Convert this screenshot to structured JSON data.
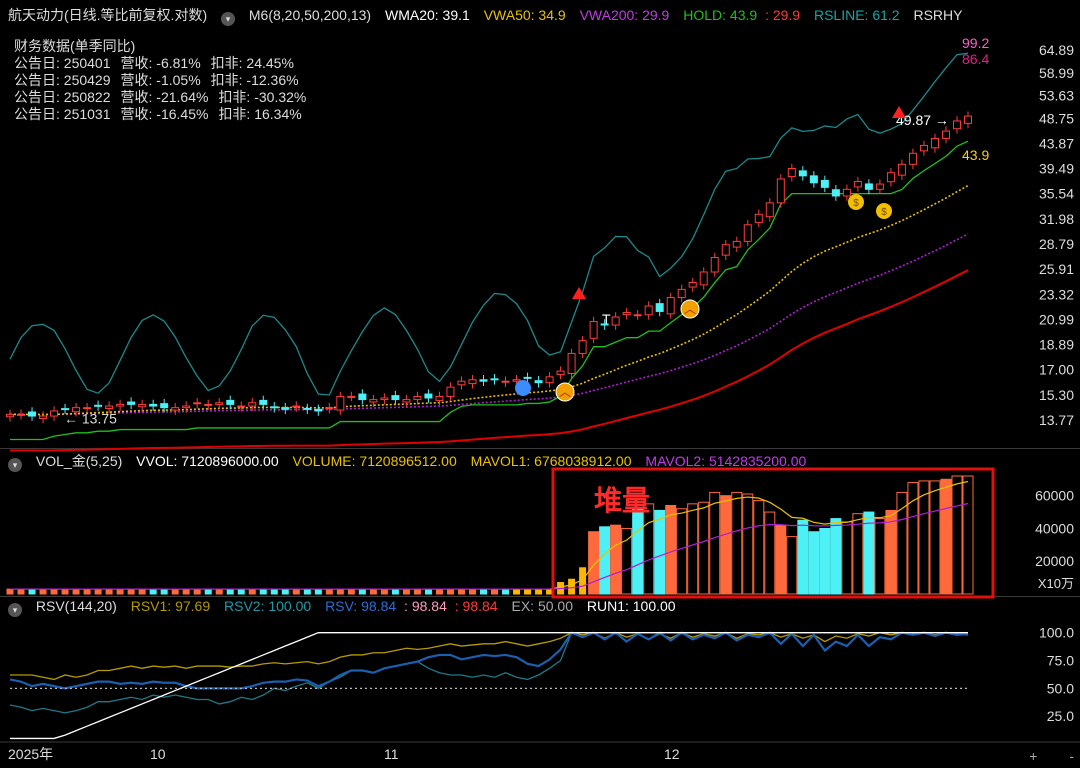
{
  "title": "航天动力(日线.等比前复权.对数)",
  "main_header": {
    "m6": "M6(8,20,50,200,13)",
    "wma20": "WMA20: 39.1",
    "vwa50": "VWA50: 34.9",
    "vwa200": "VWA200: 29.9",
    "hold": "HOLD: 43.9",
    "hold_val2": ": 29.9",
    "rsline": "RSLINE: 61.2",
    "rsrhy": "RSRHY"
  },
  "financial": {
    "title": "财务数据(单季同比)",
    "rows": [
      {
        "date": "公告日: 250401",
        "rev": "营收:  -6.81%",
        "net": "扣非:  24.45%"
      },
      {
        "date": "公告日: 250429",
        "rev": "营收:  -1.05%",
        "net": "扣非:  -12.36%"
      },
      {
        "date": "公告日: 250822",
        "rev": "营收:  -21.64%",
        "net": "扣非:  -30.32%"
      },
      {
        "date": "公告日: 251031",
        "rev": "营收:  -16.45%",
        "net": "扣非:  16.34%"
      }
    ]
  },
  "annotations": {
    "low_label": "13.75",
    "high_label": "49.87",
    "rs_val_pink": "99.2",
    "rs_val_magenta": "86.4",
    "hold_label": "43.9",
    "t_marker": "T",
    "stacked_volume": "堆量"
  },
  "vol_header": {
    "name": "VOL_金(5,25)",
    "vvol": "VVOL: 7120896000.00",
    "volume": "VOLUME: 7120896512.00",
    "mavol1": "MAVOL1: 6768038912.00",
    "mavol2": "MAVOL2: 5142835200.00"
  },
  "rsv_header": {
    "name": "RSV(144,20)",
    "rsv1": "RSV1: 97.69",
    "rsv2": "RSV2: 100.00",
    "rsv": "RSV: 98.84",
    "v1": ": 98.84",
    "v2": ": 98.84",
    "ex": "EX: 50.00",
    "run1": "RUN1: 100.00"
  },
  "x_axis": {
    "labels": [
      "2025年",
      "10",
      "11",
      "12"
    ]
  },
  "vol_unit": "X10万",
  "nav": {
    "plus": "+",
    "minus": "-"
  },
  "colors": {
    "up": "#ff3b3b",
    "down": "#4df0f5",
    "wma20": "#ffd400",
    "vwa50": "#e8c200",
    "vwa200": "#b01ed8",
    "hold": "#1fbf1f",
    "red": "#e00000",
    "rsline": "#1b8a8a",
    "white": "#ffffff",
    "rsv1": "#b59a00",
    "rsv2": "#1d7a86",
    "rsv": "#1a5fb0",
    "pink": "#ff9cc0",
    "vol_up": "#ff6a3d",
    "vol_gold": "#ffb400",
    "frame": "#e01010"
  },
  "chart_data": [
    {
      "type": "candlestick",
      "title": "航天动力(日线.等比前复权.对数)",
      "y_scale": "log",
      "y_ticks": [
        64.89,
        58.99,
        53.63,
        48.75,
        43.87,
        39.49,
        35.54,
        31.98,
        28.79,
        25.91,
        23.32,
        20.99,
        18.89,
        17.0,
        15.3,
        13.77
      ],
      "x_labels": [
        "2025年",
        "10",
        "11",
        "12"
      ],
      "close": [
        14.1,
        14.1,
        14.0,
        14.0,
        14.3,
        14.4,
        14.5,
        14.5,
        14.6,
        14.6,
        14.7,
        14.7,
        14.7,
        14.6,
        14.5,
        14.5,
        14.6,
        14.8,
        14.7,
        14.8,
        14.7,
        14.6,
        14.8,
        14.7,
        14.5,
        14.4,
        14.6,
        14.4,
        14.3,
        14.5,
        15.2,
        15.2,
        15.0,
        15.0,
        15.1,
        15.0,
        15.0,
        15.2,
        15.1,
        15.2,
        15.8,
        16.2,
        16.3,
        16.2,
        16.3,
        16.2,
        16.3,
        16.4,
        16.1,
        16.5,
        16.9,
        18.2,
        19.2,
        20.8,
        20.5,
        21.2,
        21.6,
        21.4,
        22.2,
        21.7,
        23.0,
        23.8,
        24.5,
        25.6,
        27.2,
        28.7,
        29.1,
        31.2,
        32.6,
        34.2,
        37.8,
        39.5,
        38.3,
        37.2,
        36.5,
        35.2,
        36.2,
        37.4,
        36.2,
        37.0,
        38.8,
        40.2,
        42.1,
        43.5,
        44.8,
        46.2,
        48.2,
        49.2
      ],
      "volume_x10wan": [
        3000,
        3000,
        3000,
        3000,
        3000,
        3000,
        3000,
        3000,
        3000,
        3000,
        3000,
        3000,
        3000,
        3000,
        3000,
        3000,
        3000,
        3000,
        3000,
        3000,
        3000,
        3000,
        3000,
        3000,
        3000,
        3000,
        3000,
        3000,
        3000,
        3000,
        3000,
        3000,
        3000,
        3000,
        3000,
        3000,
        3000,
        3000,
        3000,
        3000,
        3000,
        3000,
        3000,
        3000,
        3000,
        3000,
        3000,
        3000,
        3000,
        3000,
        7000,
        9000,
        16000,
        38000,
        41000,
        42000,
        40000,
        52000,
        55000,
        51000,
        54000,
        52000,
        55000,
        56000,
        62000,
        60000,
        62000,
        61000,
        57000,
        50000,
        42000,
        35000,
        45000,
        38000,
        40000,
        46000,
        44000,
        49000,
        50000,
        46000,
        51000,
        62000,
        68000,
        69000,
        69000,
        70000,
        72000,
        72000
      ],
      "ylim_volume": [
        0,
        72000
      ]
    },
    {
      "type": "line",
      "title": "RSV(144,20)",
      "y_ticks": [
        100.0,
        75.0,
        50.0,
        25.0
      ],
      "series": [
        {
          "name": "RSV1",
          "values": [
            62,
            62,
            62,
            60,
            58,
            62,
            60,
            62,
            66,
            66,
            68,
            70,
            68,
            70,
            69,
            70,
            68,
            70,
            70,
            70,
            69,
            70,
            70,
            72,
            73,
            72,
            73,
            74,
            72,
            74,
            78,
            80,
            80,
            82,
            82,
            84,
            86,
            85,
            86,
            88,
            90,
            88,
            89,
            90,
            90,
            92,
            90,
            88,
            90,
            92,
            95,
            100,
            98,
            100,
            95,
            100,
            96,
            99,
            94,
            99,
            95,
            100,
            96,
            99,
            97,
            100,
            95,
            99,
            98,
            100,
            96,
            99,
            95,
            98,
            92,
            97,
            95,
            99,
            97,
            100,
            98,
            100,
            99,
            100,
            98,
            100,
            99,
            98
          ]
        },
        {
          "name": "RSV2",
          "values": [
            35,
            33,
            30,
            32,
            30,
            28,
            30,
            33,
            38,
            38,
            40,
            42,
            40,
            44,
            42,
            44,
            42,
            40,
            40,
            36,
            38,
            42,
            40,
            44,
            50,
            48,
            52,
            55,
            50,
            56,
            60,
            66,
            66,
            64,
            68,
            70,
            72,
            74,
            68,
            64,
            62,
            62,
            60,
            62,
            60,
            64,
            60,
            58,
            62,
            68,
            75,
            100,
            100,
            100,
            100,
            100,
            100,
            100,
            100,
            100,
            100,
            100,
            100,
            100,
            100,
            100,
            100,
            100,
            100,
            100,
            100,
            100,
            100,
            100,
            100,
            100,
            100,
            100,
            100,
            100,
            100,
            100,
            100,
            100,
            100,
            100,
            100,
            100
          ]
        },
        {
          "name": "RSV",
          "values": [
            58,
            56,
            52,
            54,
            52,
            50,
            52,
            54,
            56,
            56,
            54,
            55,
            54,
            56,
            55,
            55,
            52,
            50,
            50,
            50,
            50,
            50,
            52,
            55,
            56,
            56,
            58,
            57,
            52,
            56,
            62,
            66,
            66,
            64,
            68,
            70,
            72,
            74,
            78,
            80,
            80,
            76,
            78,
            80,
            79,
            80,
            78,
            72,
            70,
            76,
            85,
            100,
            96,
            100,
            94,
            100,
            92,
            99,
            94,
            100,
            93,
            100,
            94,
            98,
            95,
            100,
            93,
            98,
            96,
            100,
            90,
            99,
            88,
            98,
            84,
            92,
            88,
            98,
            88,
            96,
            94,
            100,
            98,
            100,
            97,
            100,
            98,
            99
          ]
        },
        {
          "name": "EX",
          "values": [
            50,
            50,
            50,
            50,
            50,
            50,
            50,
            50,
            50,
            50,
            50,
            50,
            50,
            50,
            50,
            50,
            50,
            50,
            50,
            50,
            50,
            50,
            50,
            50,
            50,
            50,
            50,
            50,
            50,
            50,
            50,
            50,
            50,
            50,
            50,
            50,
            50,
            50,
            50,
            50,
            50,
            50,
            50,
            50,
            50,
            50,
            50,
            50,
            50,
            50,
            50,
            50,
            50,
            50,
            50,
            50,
            50,
            50,
            50,
            50,
            50,
            50,
            50,
            50,
            50,
            50,
            50,
            50,
            50,
            50,
            50,
            50,
            50,
            50,
            50,
            50,
            50,
            50,
            50,
            50,
            50,
            50,
            50,
            50,
            50,
            50,
            50,
            50
          ]
        },
        {
          "name": "RUN1",
          "values": [
            5,
            5,
            5,
            5,
            5,
            8,
            12,
            16,
            20,
            24,
            28,
            32,
            36,
            40,
            44,
            48,
            52,
            56,
            60,
            64,
            68,
            72,
            76,
            80,
            84,
            88,
            92,
            96,
            100,
            100,
            100,
            100,
            100,
            100,
            100,
            100,
            100,
            100,
            100,
            100,
            100,
            100,
            100,
            100,
            100,
            100,
            100,
            100,
            100,
            100,
            100,
            100,
            100,
            100,
            100,
            100,
            100,
            100,
            100,
            100,
            100,
            100,
            100,
            100,
            100,
            100,
            100,
            100,
            100,
            100,
            100,
            100,
            100,
            100,
            100,
            100,
            100,
            100,
            100,
            100,
            100,
            100,
            100,
            100,
            100,
            100,
            100,
            100
          ]
        }
      ]
    }
  ]
}
